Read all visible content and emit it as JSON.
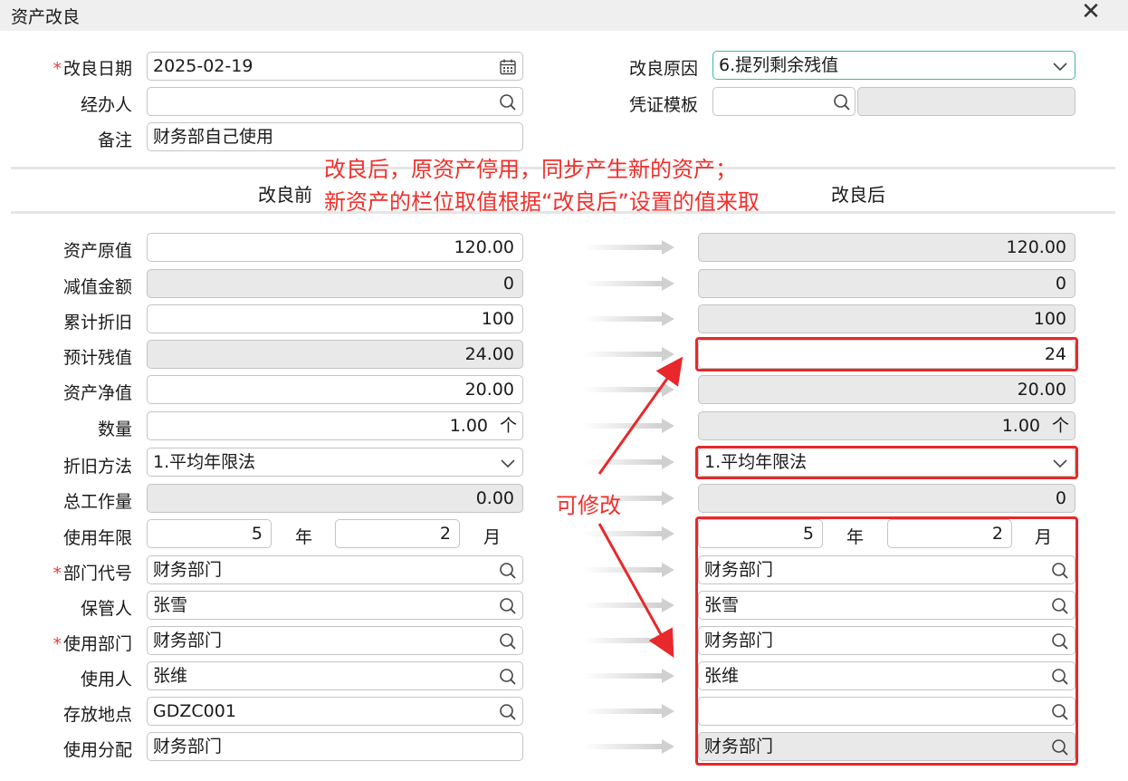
{
  "window": {
    "title": "资产改良"
  },
  "header": {
    "improve_date": {
      "label": "改良日期",
      "value": "2025-02-19"
    },
    "handler": {
      "label": "经办人",
      "value": ""
    },
    "remark": {
      "label": "备注",
      "value": "财务部自己使用"
    },
    "reason": {
      "label": "改良原因",
      "value": "6.提列剩余残值"
    },
    "voucher": {
      "label": "凭证模板",
      "value": "",
      "name": ""
    }
  },
  "columns": {
    "before": "改良前",
    "after": "改良后"
  },
  "annotation": {
    "line1": "改良后，原资产停用，同步产生新的资产；",
    "line2": "新资产的栏位取值根据“改良后”设置的值来取",
    "editable": "可修改"
  },
  "rows": [
    {
      "label": "资产原值",
      "before": "120.00",
      "after": "120.00"
    },
    {
      "label": "减值金额",
      "before": "0",
      "after": "0"
    },
    {
      "label": "累计折旧",
      "before": "100",
      "after": "100"
    },
    {
      "label": "预计残值",
      "before": "24.00",
      "after": "24"
    },
    {
      "label": "资产净值",
      "before": "20.00",
      "after": "20.00"
    },
    {
      "label": "数量",
      "before": "1.00",
      "after": "1.00",
      "unit": "个"
    },
    {
      "label": "折旧方法",
      "before": "1.平均年限法",
      "after": "1.平均年限法"
    },
    {
      "label": "总工作量",
      "before": "0.00",
      "after": "0"
    },
    {
      "label": "使用年限",
      "before_years": "5",
      "before_months": "2",
      "after_years": "5",
      "after_months": "2",
      "year_unit": "年",
      "month_unit": "月"
    },
    {
      "label": "部门代号",
      "before": "财务部门",
      "after": "财务部门"
    },
    {
      "label": "保管人",
      "before": "张雪",
      "after": "张雪"
    },
    {
      "label": "使用部门",
      "before": "财务部门",
      "after": "财务部门"
    },
    {
      "label": "使用人",
      "before": "张维",
      "after": "张维"
    },
    {
      "label": "存放地点",
      "before": "GDZC001",
      "after": ""
    },
    {
      "label": "使用分配",
      "before": "财务部门",
      "after": "财务部门"
    }
  ],
  "colors": {
    "highlight": "#e8282b",
    "annotation": "#f0302c",
    "focus_border": "#3fb8a8"
  }
}
